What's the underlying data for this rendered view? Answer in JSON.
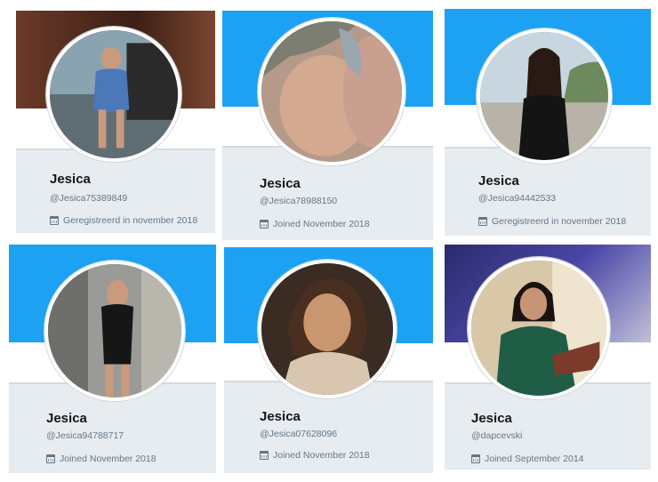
{
  "profiles": [
    {
      "name": "Jesica",
      "handle": "@Jesica75389849",
      "joined": "Geregistreerd in november 2018",
      "banner_color": "#5a2e22",
      "avatar_description": "woman in blue dress on balcony"
    },
    {
      "name": "Jesica",
      "handle": "@Jesica78988150",
      "joined": "Joined November 2018",
      "banner_color": "#1da1f2",
      "avatar_description": "two women kissing close-up"
    },
    {
      "name": "Jesica",
      "handle": "@Jesica94442533",
      "joined": "Geregistreerd in november 2018",
      "banner_color": "#1da1f2",
      "avatar_description": "woman in black top at seaside"
    },
    {
      "name": "Jesica",
      "handle": "@Jesica94788717",
      "joined": "Joined November 2018",
      "banner_color": "#1da1f2",
      "avatar_description": "woman in black dress in elevator"
    },
    {
      "name": "Jesica",
      "handle": "@Jesica07628096",
      "joined": "Joined November 2018",
      "banner_color": "#1da1f2",
      "avatar_description": "smiling woman with scarf"
    },
    {
      "name": "Jesica",
      "handle": "@dapcevski",
      "joined": "Joined September 2014",
      "banner_color": "#3a3580",
      "avatar_description": "woman in green sequin dress"
    }
  ],
  "icons": {
    "calendar": "calendar-icon"
  }
}
